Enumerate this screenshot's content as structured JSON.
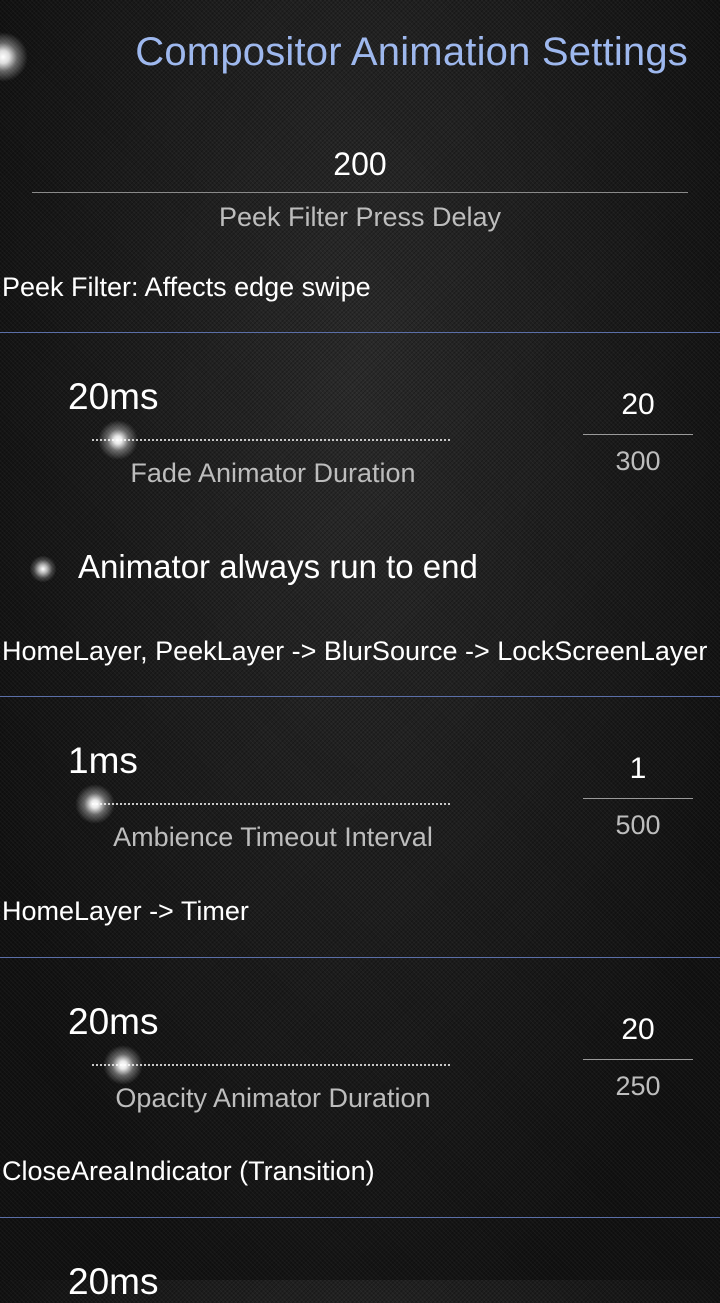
{
  "header": {
    "title": "Compositor Animation Settings"
  },
  "peek_filter": {
    "value": "200",
    "label": "Peek Filter Press Delay",
    "description": "Peek Filter: Affects edge swipe"
  },
  "settings": [
    {
      "value_display": "20ms",
      "label": "Fade Animator Duration",
      "input_value": "20",
      "max": "300",
      "slider_fraction": 0.067
    },
    {
      "value_display": "1ms",
      "label": "Ambience Timeout Interval",
      "input_value": "1",
      "max": "500",
      "slider_fraction": 0.002
    },
    {
      "value_display": "20ms",
      "label": "Opacity Animator Duration",
      "input_value": "20",
      "max": "250",
      "slider_fraction": 0.08
    },
    {
      "value_display": "20ms"
    }
  ],
  "switch": {
    "label": "Animator always run to end",
    "checked": false
  },
  "descriptions": {
    "fade": "HomeLayer, PeekLayer -> BlurSource -> LockScreenLayer",
    "ambience": "HomeLayer -> Timer",
    "opacity": "CloseAreaIndicator (Transition)"
  },
  "colors": {
    "title": "#9eb8ee",
    "separator": "#5b6fa8",
    "background": "#141414"
  },
  "icons": {
    "pulley": "glow-indicator-icon",
    "switch": "switch-indicator-icon",
    "slider_thumb": "slider-handle-icon"
  }
}
